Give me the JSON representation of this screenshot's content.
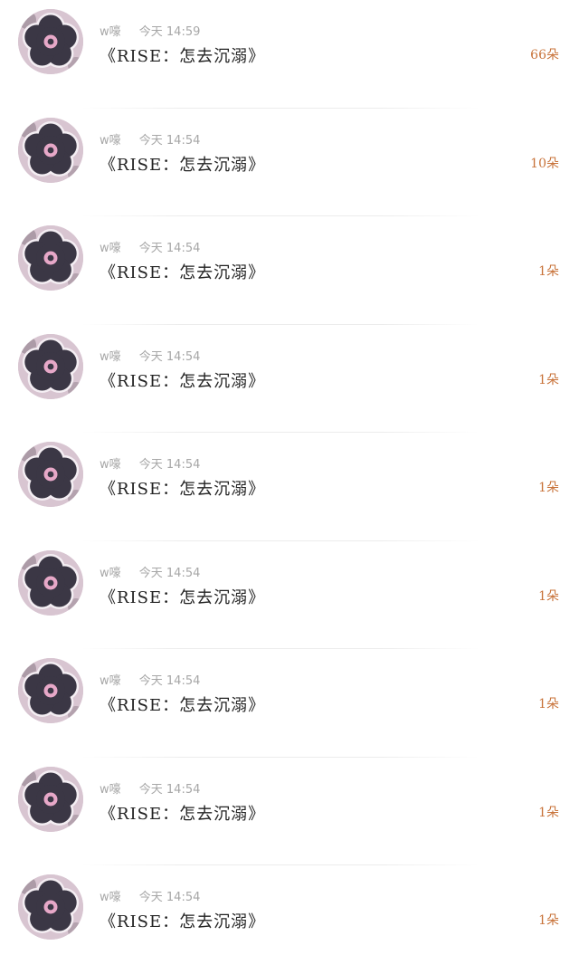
{
  "items": [
    {
      "sender": "w嚎",
      "time": "今天 14:59",
      "title": "《RISE：怎去沉溺》",
      "count": "66朵"
    },
    {
      "sender": "w嚎",
      "time": "今天 14:54",
      "title": "《RISE：怎去沉溺》",
      "count": "10朵"
    },
    {
      "sender": "w嚎",
      "time": "今天 14:54",
      "title": "《RISE：怎去沉溺》",
      "count": "1朵"
    },
    {
      "sender": "w嚎",
      "time": "今天 14:54",
      "title": "《RISE：怎去沉溺》",
      "count": "1朵"
    },
    {
      "sender": "w嚎",
      "time": "今天 14:54",
      "title": "《RISE：怎去沉溺》",
      "count": "1朵"
    },
    {
      "sender": "w嚎",
      "time": "今天 14:54",
      "title": "《RISE：怎去沉溺》",
      "count": "1朵"
    },
    {
      "sender": "w嚎",
      "time": "今天 14:54",
      "title": "《RISE：怎去沉溺》",
      "count": "1朵"
    },
    {
      "sender": "w嚎",
      "time": "今天 14:54",
      "title": "《RISE：怎去沉溺》",
      "count": "1朵"
    },
    {
      "sender": "w嚎",
      "time": "今天 14:54",
      "title": "《RISE：怎去沉溺》",
      "count": "1朵"
    }
  ],
  "colors": {
    "count": "#c8733a",
    "title": "#222222",
    "meta": "#a7a7a7",
    "avatar_flower": "#3b3745",
    "avatar_outline": "#f4eef3",
    "avatar_center": "#e7a8c8"
  },
  "icons": {
    "avatar": "flower-avatar-icon"
  }
}
